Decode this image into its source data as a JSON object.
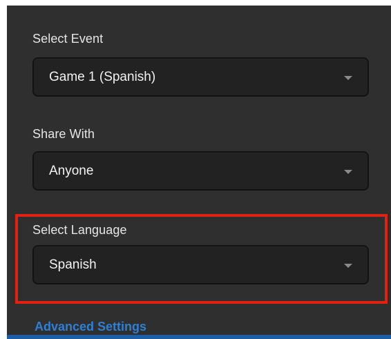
{
  "form": {
    "event": {
      "label": "Select Event",
      "value": "Game 1 (Spanish)"
    },
    "share": {
      "label": "Share With",
      "value": "Anyone"
    },
    "language": {
      "label": "Select Language",
      "value": "Spanish"
    },
    "advanced_settings_link": "Advanced Settings"
  },
  "colors": {
    "panel_background": "#2f2f2f",
    "dropdown_background": "#222222",
    "highlight_outline": "#e3210f",
    "link": "#2f7fd3"
  },
  "icons": {
    "dropdown_arrow": "chevron-down-icon"
  }
}
